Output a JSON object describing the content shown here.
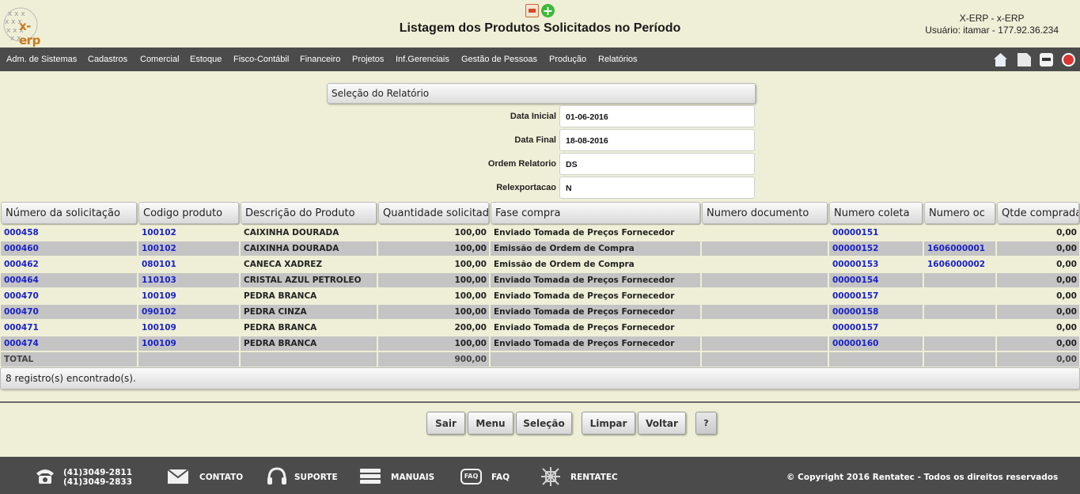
{
  "header": {
    "logo_text": "x-erp",
    "title": "Listagem dos Produtos Solicitados no Período",
    "system_name": "X-ERP - x-ERP",
    "user_info": "Usuário: itamar - 177.92.36.234",
    "add_symbol": "+"
  },
  "menu": {
    "items": [
      "Adm. de Sistemas",
      "Cadastros",
      "Comercial",
      "Estoque",
      "Fisco-Contábil",
      "Financeiro",
      "Projetos",
      "Inf.Gerenciais",
      "Gestão de Pessoas",
      "Produção",
      "Relatórios"
    ],
    "toolbar_icons": [
      "home-icon",
      "document-icon",
      "print-icon",
      "power-icon"
    ]
  },
  "selection": {
    "title": "Seleção do Relatório",
    "fields": [
      {
        "label": "Data Inicial",
        "value": "01-06-2016"
      },
      {
        "label": "Data Final",
        "value": "18-08-2016"
      },
      {
        "label": "Ordem Relatorio",
        "value": "DS"
      },
      {
        "label": "Relexportacao",
        "value": "N"
      }
    ]
  },
  "table": {
    "columns": [
      "Número da solicitação",
      "Codigo produto",
      "Descrição do Produto",
      "Quantidade solicitada",
      "Fase compra",
      "Numero documento",
      "Numero coleta",
      "Numero oc",
      "Qtde comprada"
    ],
    "rows": [
      [
        "000458",
        "100102",
        "CAIXINHA DOURADA",
        "100,00",
        "Enviado Tomada de Preços Fornecedor",
        "",
        "00000151",
        "",
        "0,00"
      ],
      [
        "000460",
        "100102",
        "CAIXINHA DOURADA",
        "100,00",
        "Emissão de Ordem de Compra",
        "",
        "00000152",
        "1606000001",
        "0,00"
      ],
      [
        "000462",
        "080101",
        "CANECA XADREZ",
        "100,00",
        "Emissão de Ordem de Compra",
        "",
        "00000153",
        "1606000002",
        "0,00"
      ],
      [
        "000464",
        "110103",
        "CRISTAL AZUL PETROLEO",
        "100,00",
        "Enviado Tomada de Preços Fornecedor",
        "",
        "00000154",
        "",
        "0,00"
      ],
      [
        "000470",
        "100109",
        "PEDRA BRANCA",
        "100,00",
        "Enviado Tomada de Preços Fornecedor",
        "",
        "00000157",
        "",
        "0,00"
      ],
      [
        "000470",
        "090102",
        "PEDRA CINZA",
        "100,00",
        "Enviado Tomada de Preços Fornecedor",
        "",
        "00000158",
        "",
        "0,00"
      ],
      [
        "000471",
        "100109",
        "PEDRA BRANCA",
        "200,00",
        "Enviado Tomada de Preços Fornecedor",
        "",
        "00000157",
        "",
        "0,00"
      ],
      [
        "000474",
        "100109",
        "PEDRA BRANCA",
        "100,00",
        "Enviado Tomada de Preços Fornecedor",
        "",
        "00000160",
        "",
        "0,00"
      ]
    ],
    "total_row": [
      "TOTAL",
      "",
      "",
      "900,00",
      "",
      "",
      "",
      "",
      "0,00"
    ],
    "record_count": "8 registro(s) encontrado(s)."
  },
  "buttons": [
    "Sair",
    "Menu",
    "Seleção",
    "Limpar",
    "Voltar",
    "?"
  ],
  "footer": {
    "phone_1": "(41)3049-2811",
    "phone_2": "(41)3049-2833",
    "links": [
      "CONTATO",
      "SUPORTE",
      "MANUAIS",
      "FAQ",
      "RENTATEC"
    ],
    "faq_icon_label": "FAQ",
    "copyright": "© Copyright 2016 Rentatec - Todos os direitos reservados"
  },
  "colors": {
    "background": "#efefd7",
    "menu_bg": "#4b4b4b",
    "link_blue": "#1a22c8",
    "row_alt": "#c4c4c4"
  }
}
